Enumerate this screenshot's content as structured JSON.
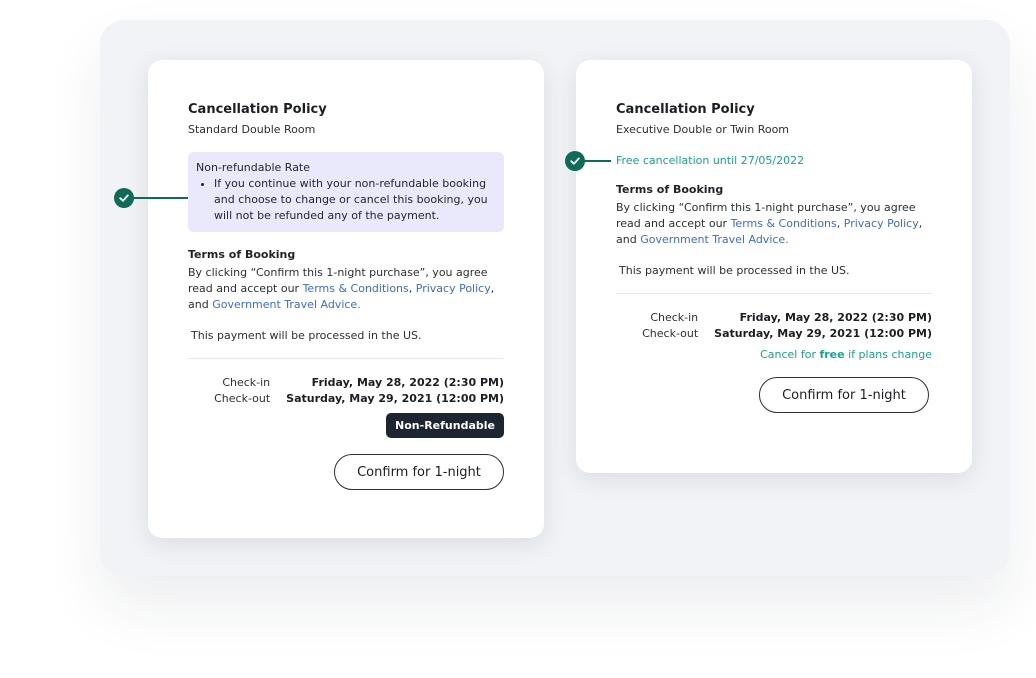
{
  "colors": {
    "accent_green": "#0f6b57",
    "free_green": "#1aa28a",
    "link_blue": "#3a6ccf",
    "badge_dark": "#1d2630",
    "nr_box_bg": "#e9e9fb"
  },
  "left": {
    "title": "Cancellation Policy",
    "room": "Standard Double Room",
    "nr_title": "Non-refundable Rate",
    "nr_bullet": "If you continue with your non-refundable booking and choose to change or cancel this booking, you will not be refunded any of the payment.",
    "terms_heading": "Terms of Booking",
    "terms_pre": "By clicking “Confirm this 1-night purchase”, you agree read and accept our ",
    "terms_link1": "Terms & Conditions",
    "terms_sep": ", ",
    "terms_link2": "Privacy Policy",
    "terms_and": ", and ",
    "terms_link3": "Government Travel Advice.",
    "processed": "This payment will be processed in the US.",
    "checkin_label": "Check-in",
    "checkin_value": "Friday, May 28, 2022 (2:30 PM)",
    "checkout_label": "Check-out",
    "checkout_value": "Saturday, May 29, 2021 (12:00 PM)",
    "badge": "Non-Refundable",
    "confirm": "Confirm for 1-night"
  },
  "right": {
    "title": "Cancellation Policy",
    "room": "Executive Double or Twin Room",
    "free_cancel": "Free cancellation until 27/05/2022",
    "terms_heading": "Terms of Booking",
    "terms_pre": "By clicking “Confirm this 1-night purchase”, you agree read and accept our ",
    "terms_link1": "Terms & Conditions",
    "terms_sep": ", ",
    "terms_link2": "Privacy Policy",
    "terms_and": ", and ",
    "terms_link3": "Government Travel Advice.",
    "processed": "This payment will be processed in the US.",
    "checkin_label": "Check-in",
    "checkin_value": "Friday, May 28, 2022 (2:30 PM)",
    "checkout_label": "Check-out",
    "checkout_value": "Saturday, May 29, 2021 (12:00 PM)",
    "cancel_pre": "Cancel for ",
    "cancel_free": "free",
    "cancel_post": " if plans change",
    "confirm": "Confirm for 1-night"
  },
  "icons": {
    "marker": "check-circle-icon"
  }
}
